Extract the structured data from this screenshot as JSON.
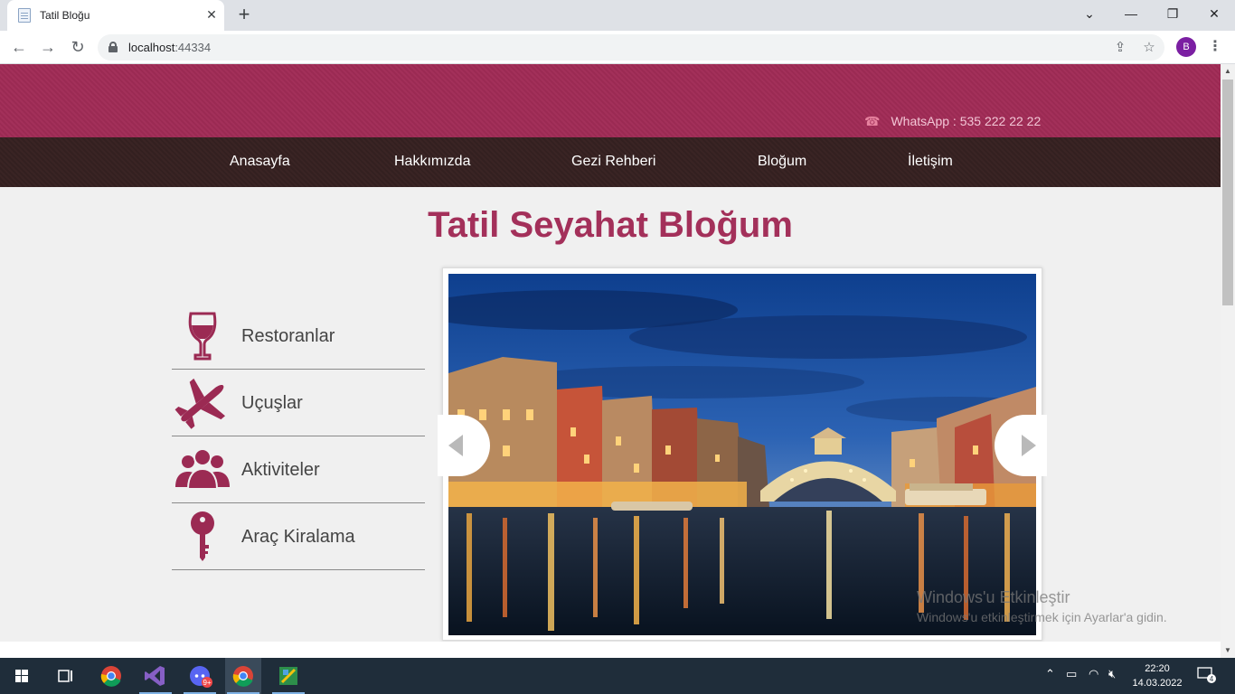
{
  "browser": {
    "tab_title": "Tatil Bloğu",
    "new_tab": "+",
    "url_host": "localhost",
    "url_port": ":44334",
    "profile_initial": "B"
  },
  "site": {
    "whatsapp": "WhatsApp : 535 222 22 22",
    "nav": [
      "Anasayfa",
      "Hakkımızda",
      "Gezi Rehberi",
      "Bloğum",
      "İletişim"
    ],
    "title": "Tatil Seyahat Bloğum",
    "features": [
      {
        "label": "Restoranlar",
        "icon": "wine-glass-icon"
      },
      {
        "label": "Uçuşlar",
        "icon": "airplane-icon"
      },
      {
        "label": "Aktiviteler",
        "icon": "people-icon"
      },
      {
        "label": "Araç Kiralama",
        "icon": "key-icon"
      }
    ],
    "accent_color": "#a3305a",
    "nav_color": "#3a2424"
  },
  "watermark": {
    "line1": "Windows'u Etkinleştir",
    "line2": "Windows'u etkinleştirmek için Ayarlar'a gidin."
  },
  "taskbar": {
    "time": "22:20",
    "date": "14.03.2022",
    "discord_badge": "9+",
    "notification_count": "4"
  }
}
